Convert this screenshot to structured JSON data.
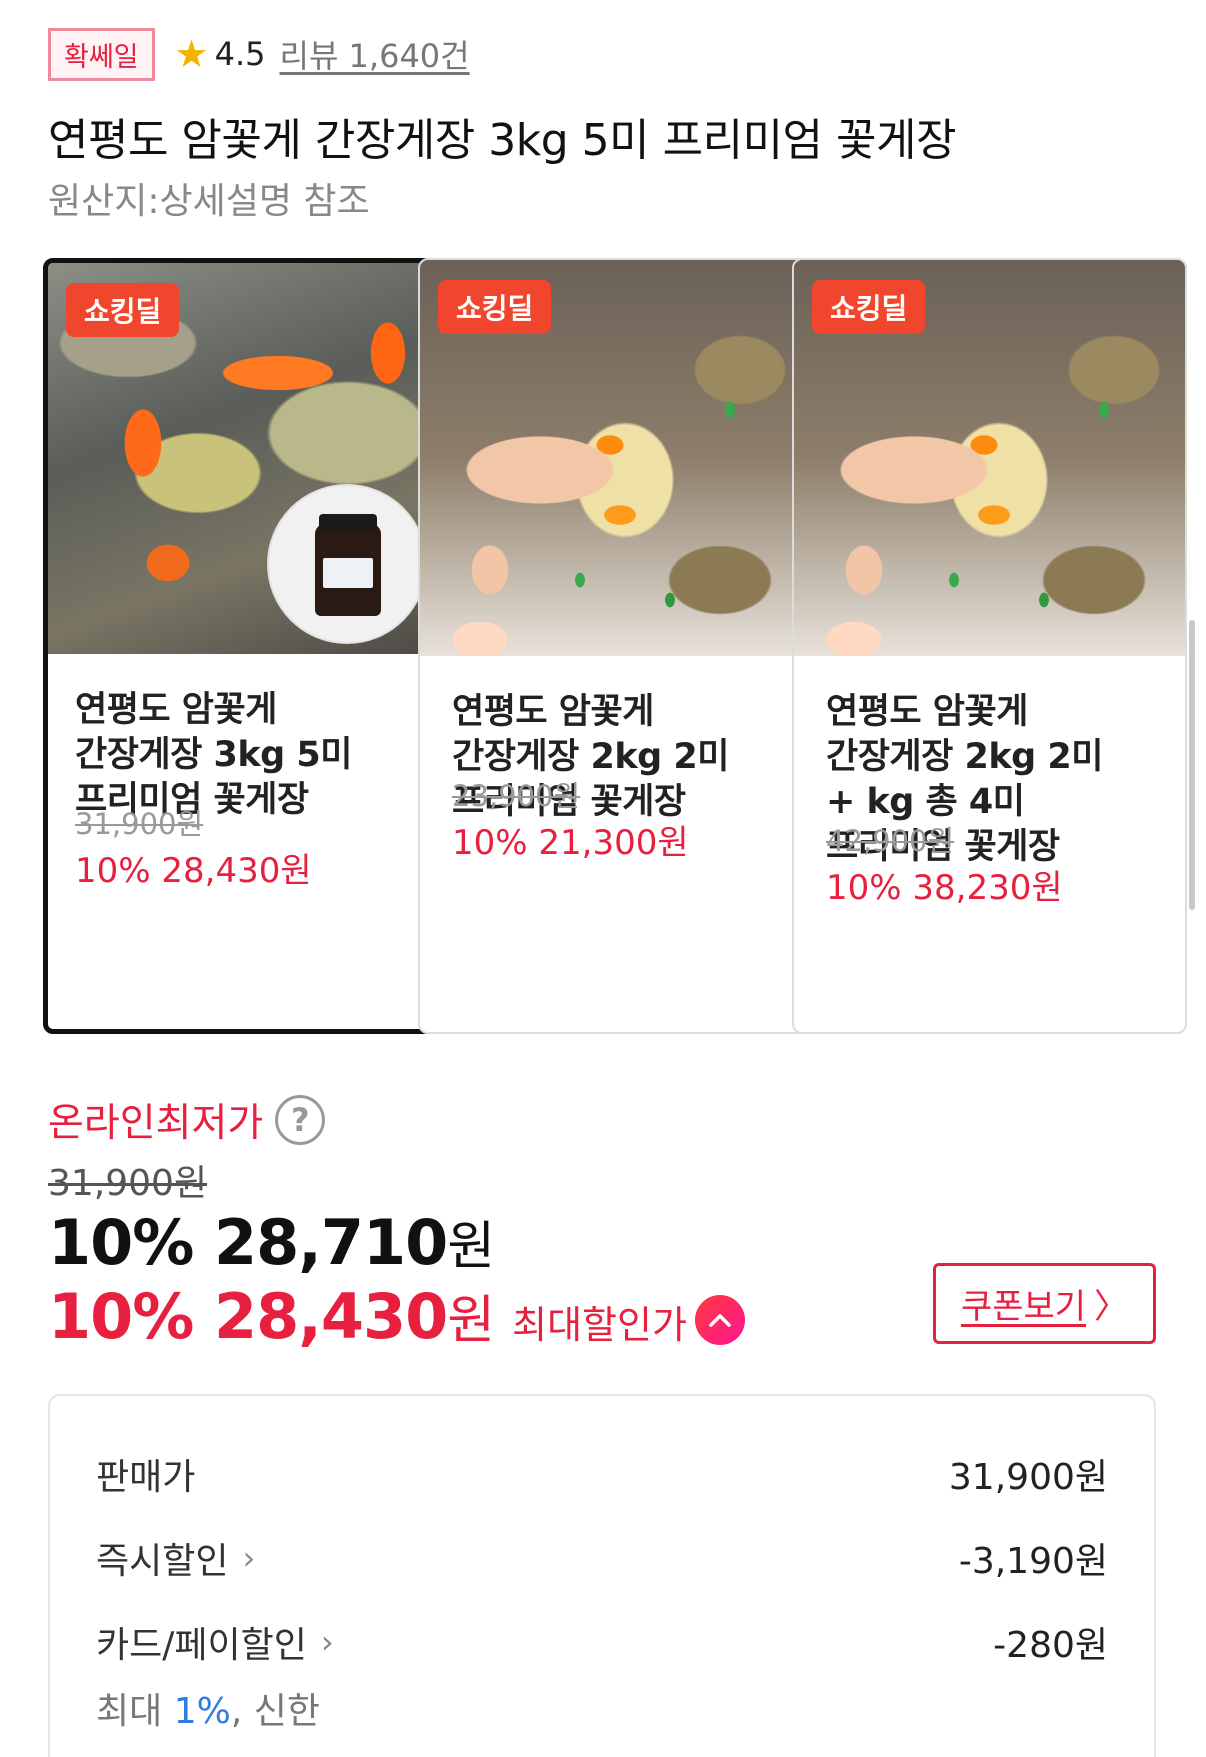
{
  "header": {
    "sale_badge": "확쎄일",
    "rating": "4.5",
    "review_link": "리뷰 1,640건",
    "title": "연평도 암꽃게 간장게장 3kg 5미 프리미엄 꽃게장",
    "origin": "원산지:상세설명 참조"
  },
  "options": [
    {
      "badge": "쇼킹딜",
      "title": "연평도 암꽃게 간장게장 3kg 5미 프리미엄 꽃게장",
      "original_price": "31,900원",
      "price": "10% 28,430원",
      "selected": true
    },
    {
      "badge": "쇼킹딜",
      "title": "연평도 암꽃게 간장게장 2kg 2미 프리미엄 꽃게장",
      "original_price": "23,900원",
      "price": "10% 21,300원",
      "selected": false
    },
    {
      "badge": "쇼킹딜",
      "title": "연평도 암꽃게 간장게장 2kg 2미 + kg 총 4미 프리미엄 꽃게장",
      "original_price": "42,900원",
      "price": "10% 38,230원",
      "selected": false
    }
  ],
  "pricing": {
    "lowest_label": "온라인최저가",
    "help_symbol": "?",
    "original_price": "31,900원",
    "sale_percent": "10%",
    "sale_amount": "28,710",
    "max_percent": "10%",
    "max_amount": "28,430",
    "won": "원",
    "max_label": "최대할인가",
    "coupon_button": "쿠폰보기",
    "coupon_chevron": "〉"
  },
  "breakdown": {
    "rows": [
      {
        "label": "판매가",
        "value": "31,900원"
      },
      {
        "label": "즉시할인",
        "value": "-3,190원"
      },
      {
        "label": "카드/페이할인",
        "value": "-280원"
      }
    ],
    "card_note_prefix": "최대 ",
    "card_note_highlight": "1%",
    "card_note_suffix": ", 신한"
  },
  "colors": {
    "accent_red": "#e8203f",
    "badge_orange": "#f0462e",
    "star": "#f5b301",
    "link_blue": "#2f7de0"
  }
}
